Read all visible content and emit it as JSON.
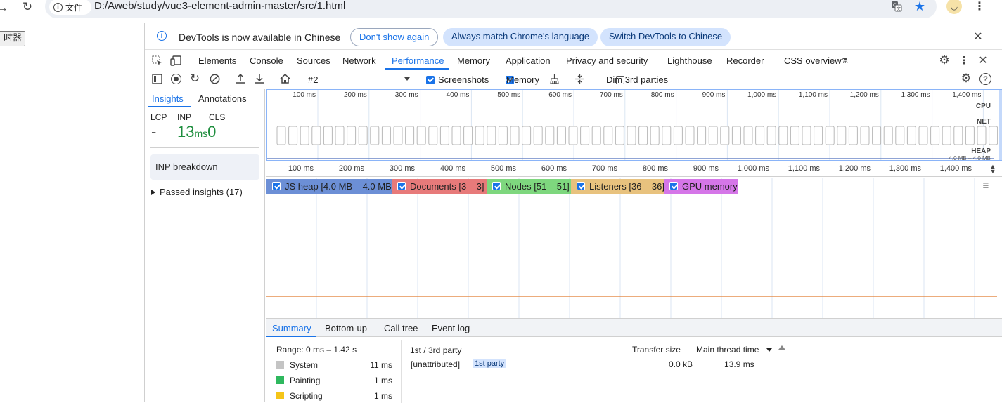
{
  "browser": {
    "back_glyph": "→",
    "reload_glyph": "↻",
    "site_info_label": "文件",
    "url": "D:/Aweb/study/vue3-element-admin-master/src/1.html"
  },
  "page": {
    "button_label": "时器"
  },
  "infobar": {
    "message": "DevTools is now available in Chinese",
    "dont_show": "Don't show again",
    "always_match": "Always match Chrome's language",
    "switch": "Switch DevTools to Chinese"
  },
  "main_tabs": {
    "elements": "Elements",
    "console": "Console",
    "sources": "Sources",
    "network": "Network",
    "performance": "Performance",
    "memory": "Memory",
    "application": "Application",
    "privacy": "Privacy and security",
    "lighthouse": "Lighthouse",
    "recorder": "Recorder",
    "css_overview": "CSS overview"
  },
  "perf_toolbar": {
    "recording": "#2",
    "screenshots": "Screenshots",
    "memory": "Memory",
    "dim_3rd": "Dim 3rd parties"
  },
  "sidebar": {
    "tab_insights": "Insights",
    "tab_annotations": "Annotations",
    "lcp_label": "LCP",
    "inp_label": "INP",
    "cls_label": "CLS",
    "lcp_value": "-",
    "inp_value": "13",
    "inp_unit": "ms",
    "cls_value": "0",
    "inp_breakdown": "INP breakdown",
    "passed_insights": "Passed insights (17)"
  },
  "overview": {
    "ticks": [
      "100 ms",
      "200 ms",
      "300 ms",
      "400 ms",
      "500 ms",
      "600 ms",
      "700 ms",
      "800 ms",
      "900 ms",
      "1,000 ms",
      "1,100 ms",
      "1,200 ms",
      "1,300 ms",
      "1,400 ms"
    ],
    "cpu": "CPU",
    "net": "NET",
    "heap": "HEAP",
    "heap_range": "4.0 MB – 4.0 MB"
  },
  "timeline": {
    "ticks": [
      "100 ms",
      "200 ms",
      "300 ms",
      "400 ms",
      "500 ms",
      "600 ms",
      "700 ms",
      "800 ms",
      "900 ms",
      "1,000 ms",
      "1,100 ms",
      "1,200 ms",
      "1,300 ms",
      "1,400 ms"
    ]
  },
  "counters": {
    "js_heap": "JS heap [4.0 MB – 4.0 MB]",
    "documents": "Documents [3 – 3]",
    "nodes": "Nodes [51 – 51]",
    "listeners": "Listeners [36 – 36]",
    "gpu": "GPU memory"
  },
  "colors": {
    "js_heap": "#6c8fd6",
    "documents": "#e77a7a",
    "nodes": "#7ed77e",
    "listeners": "#e8c27e",
    "gpu": "#d576e8",
    "accent": "#1a73e8",
    "inp_value": "#1e8e3e"
  },
  "bottom_tabs": {
    "summary": "Summary",
    "bottom_up": "Bottom-up",
    "call_tree": "Call tree",
    "event_log": "Event log"
  },
  "summary": {
    "range": "Range: 0 ms – 1.42 s",
    "rows": [
      {
        "label": "System",
        "value": "11 ms",
        "color": "#c4c4c4"
      },
      {
        "label": "Painting",
        "value": "1 ms",
        "color": "#2fb85e"
      },
      {
        "label": "Scripting",
        "value": "1 ms",
        "color": "#f5c518"
      }
    ]
  },
  "third_party": {
    "col1": "1st / 3rd party",
    "col2": "Transfer size",
    "col3": "Main thread time",
    "row_name": "[unattributed]",
    "row_badge": "1st party",
    "row_size": "0.0 kB",
    "row_time": "13.9 ms"
  }
}
